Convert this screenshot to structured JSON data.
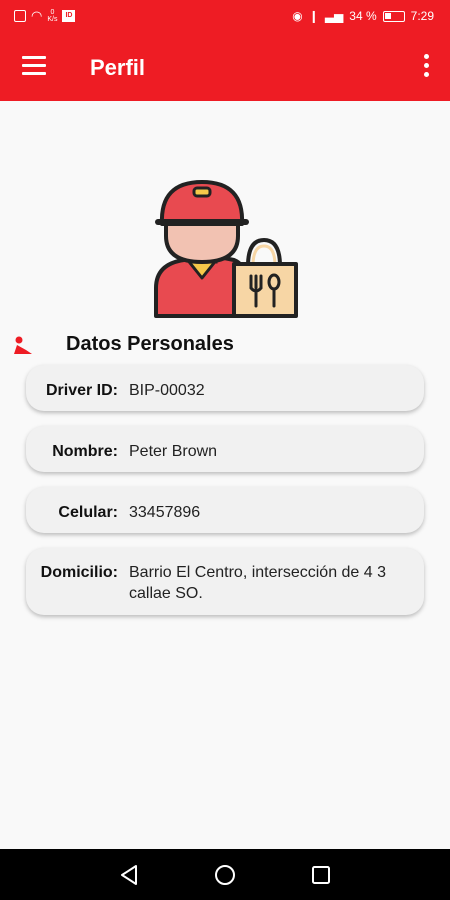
{
  "status_bar": {
    "speed_top": "0",
    "speed_bottom": "K/s",
    "box_icon_label": "ID",
    "battery_text": "34 %",
    "time": "7:29"
  },
  "app_bar": {
    "title": "Perfil",
    "menu_icon": "hamburger-menu-icon",
    "overflow_icon": "more-vertical-icon"
  },
  "colors": {
    "primary": "#ee1c24",
    "background": "#f9f9f9",
    "card": "#f1f1f1"
  },
  "profile": {
    "avatar_icon": "delivery-driver-icon",
    "section_title": "Datos Personales",
    "fields": [
      {
        "label": "Driver ID:",
        "value": "BIP-00032"
      },
      {
        "label": "Nombre:",
        "value": "Peter Brown"
      },
      {
        "label": "Celular:",
        "value": "33457896"
      },
      {
        "label": "Domicilio:",
        "value": "Barrio El Centro, intersección de 4 3 callae SO."
      }
    ]
  },
  "nav_bar": {
    "back_icon": "back-triangle-icon",
    "home_icon": "home-circle-icon",
    "recents_icon": "recents-square-icon"
  }
}
